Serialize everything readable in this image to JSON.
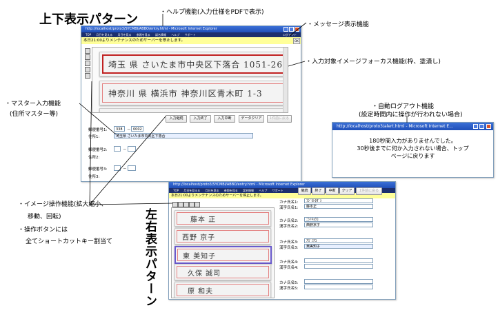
{
  "labels": {
    "top_pattern": "上下表示パターン",
    "side_pattern": "左右表示パターン"
  },
  "callouts": {
    "help": "・ヘルプ機能(入力仕様をPDFで表示)",
    "message": "・メッセージ表示機能",
    "focus": "・入力対象イメージフォーカス機能(枠、塗潰し)",
    "master_1": "・マスター入力機能",
    "master_2": "(住所マスター等)",
    "autologout_1": "・自動ログアウト機能",
    "autologout_2": "(設定時間内に操作が行われない場合)",
    "image_ops_1": "・イメージ操作機能(拡大縮小、",
    "image_ops_2": "移動、回転)",
    "buttons_1": "・操作ボタンには",
    "buttons_2": "全てショートカットキー割当て"
  },
  "window_top": {
    "title": "http://localhost/proto3/SYCMBI/ABBO/entry.html - Microsoft Internet Explorer",
    "menu": [
      "TOP",
      "月日を見える",
      "月日を見る",
      "参照を見る",
      "誤名情報",
      "ヘルプ",
      "サポート",
      "ログアウト"
    ],
    "message": "本日21:00よりメンテナンスのためサーバーを停止します。",
    "ok": "OK",
    "cards": [
      {
        "handwriting": "埼玉 県 さいたま市中央区下落合 1051-26"
      },
      {
        "handwriting": "神奈川 県 横浜市 神奈川区青木町 1-3"
      }
    ],
    "buttons": [
      "入力継続",
      "入力終了",
      "入力中断",
      "データクリア",
      "1件前に戻る"
    ],
    "form": {
      "postal1_label": "郵便番号1:",
      "postal1_a": "338",
      "postal1_sep": "－",
      "postal1_b": "0002",
      "address1_label": "住所1:",
      "address1_value": "埼玉県 さいたま市中央区下落合",
      "postal2_label": "郵便番号2:",
      "postal2_sep": "－",
      "address2_label": "住所2:",
      "postal3_label": "郵便番号3:",
      "postal3_sep": "－",
      "address3_label": "住所3:"
    }
  },
  "alert_window": {
    "title": "http://localhost/proto3/alert.html - Microsoft Internet E...",
    "line1": "180秒間入力がありませんでした。",
    "line2": "30秒後までに何か入力されない場合、トップ",
    "line3": "ページに戻ります"
  },
  "window_side": {
    "title": "http://localhost/proto3/SYCMBI/ABBO/entry.html - Microsoft Internet Explorer",
    "menu": [
      "TOP",
      "月日を見える",
      "月日を見る",
      "参照を見る",
      "誤名情報",
      "ヘルプ",
      "サポート"
    ],
    "message": "本日21:00よりメンテナンスのためサーバーを停止します。",
    "buttons": [
      "継続",
      "終了",
      "中断",
      "クリア",
      "1件前に戻る"
    ],
    "cards": [
      {
        "handwriting": "藤本 正"
      },
      {
        "handwriting": "西野 京子"
      },
      {
        "handwriting": "東 美知子"
      },
      {
        "handwriting": "久保 誠司"
      },
      {
        "handwriting": "原 和夫"
      }
    ],
    "rows": [
      {
        "kana_label": "カナ氏名1:",
        "kana": "ﾌｼﾞﾓﾄﾀﾀﾞｼ",
        "kanji_label": "漢字氏名1:",
        "kanji": "藤本正"
      },
      {
        "kana_label": "カナ氏名2:",
        "kana": "ﾆｼﾉｷｮｳｺ",
        "kanji_label": "漢字氏名2:",
        "kanji": "西野京子"
      },
      {
        "kana_label": "カナ氏名3:",
        "kana": "ｱｽﾞﾐﾁｺ",
        "kanji_label": "漢字氏名3:",
        "kanji": "東美知子"
      },
      {
        "kana_label": "カナ氏名4:",
        "kana": "",
        "kanji_label": "漢字氏名4:",
        "kanji": ""
      },
      {
        "kana_label": "カナ氏名5:",
        "kana": "",
        "kanji_label": "漢字氏名5:",
        "kanji": ""
      }
    ]
  }
}
